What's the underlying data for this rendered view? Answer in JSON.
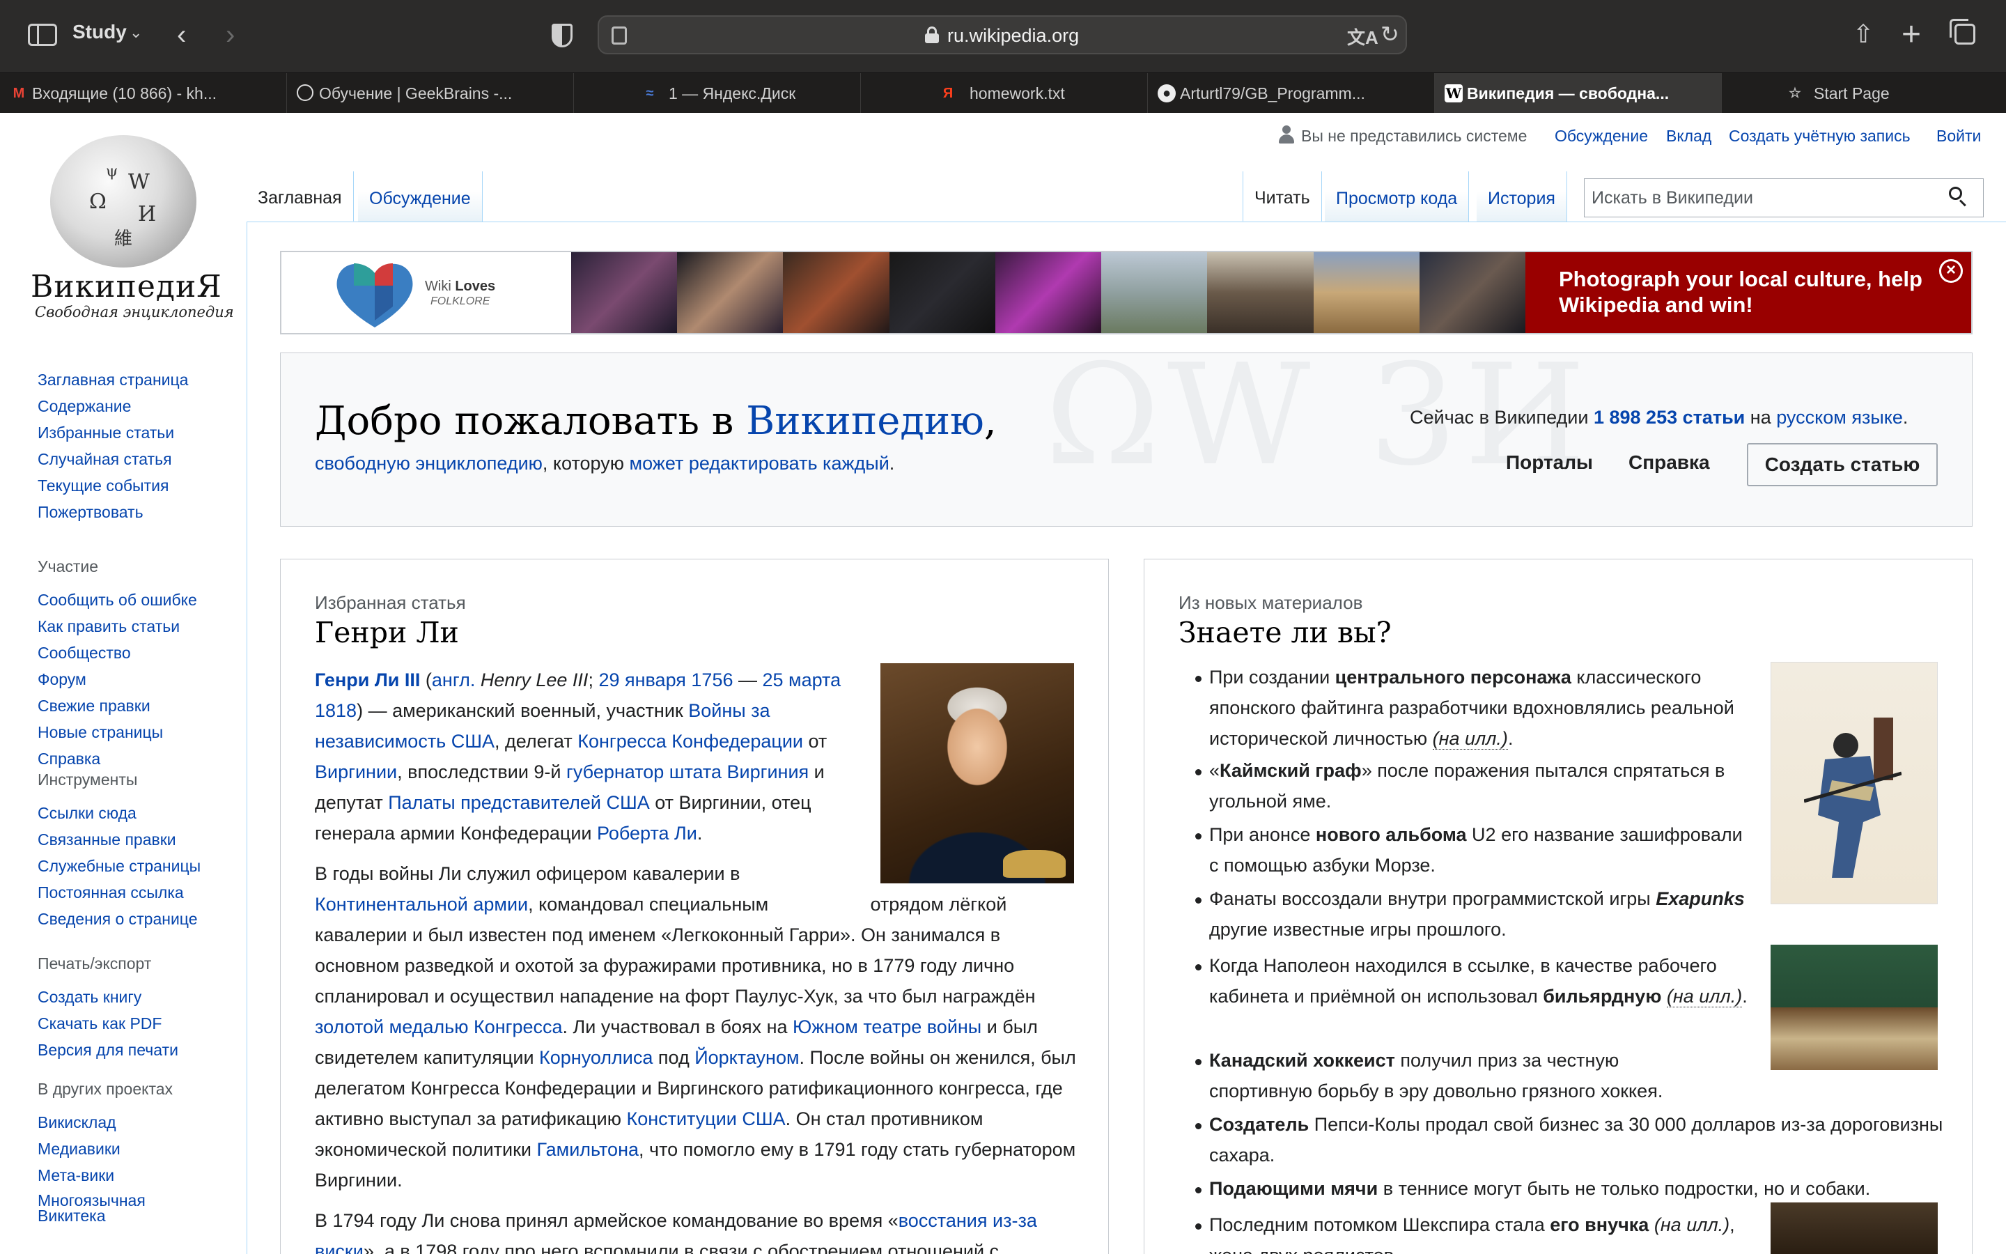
{
  "browser": {
    "tab_group": "Study",
    "url": "ru.wikipedia.org",
    "tabs": [
      {
        "title": "Входящие (10 866) - kh...",
        "icon": "gmail-icon",
        "active": false
      },
      {
        "title": "Обучение | GeekBrains -...",
        "icon": "geekbrains-icon",
        "active": false
      },
      {
        "title": "1 — Яндекс.Диск",
        "icon": "yandex-disk-icon",
        "active": false
      },
      {
        "title": "homework.txt",
        "icon": "yandex-icon",
        "active": false
      },
      {
        "title": "Arturtl79/GB_Programm...",
        "icon": "github-icon",
        "active": false
      },
      {
        "title": "Википедия — свободна...",
        "icon": "wikipedia-icon",
        "active": true
      },
      {
        "title": "Start Page",
        "icon": "star-icon",
        "active": false
      }
    ]
  },
  "personal": {
    "anon": "Вы не представились системе",
    "talk": "Обсуждение",
    "contrib": "Вклад",
    "create_account": "Создать учётную запись",
    "login": "Войти"
  },
  "logo": {
    "wordmark": "ВикипедиЯ",
    "tagline": "Свободная энциклопедия"
  },
  "sidebar": {
    "main": [
      "Заглавная страница",
      "Содержание",
      "Избранные статьи",
      "Случайная статья",
      "Текущие события",
      "Пожертвовать"
    ],
    "participation_heading": "Участие",
    "participation": [
      "Сообщить об ошибке",
      "Как править статьи",
      "Сообщество",
      "Форум",
      "Свежие правки",
      "Новые страницы",
      "Справка"
    ],
    "tools_heading": "Инструменты",
    "tools": [
      "Ссылки сюда",
      "Связанные правки",
      "Служебные страницы",
      "Постоянная ссылка",
      "Сведения о странице"
    ],
    "print_heading": "Печать/экспорт",
    "print": [
      "Создать книгу",
      "Скачать как PDF",
      "Версия для печати"
    ],
    "projects_heading": "В других проектах",
    "projects": [
      "Викисклад",
      "Медиавики",
      "Мета-вики",
      "Многоязычная Викитека"
    ]
  },
  "content_tabs": {
    "main": "Заглавная",
    "talk": "Обсуждение",
    "read": "Читать",
    "view_source": "Просмотр кода",
    "history": "История"
  },
  "search": {
    "placeholder": "Искать в Википедии"
  },
  "banner": {
    "logo_title_a": "Wiki ",
    "logo_title_b": "Loves",
    "logo_sub": "FOLKLORE",
    "cta": "Photograph your local culture, help Wikipedia and win!"
  },
  "welcome": {
    "title_prefix": "Добро пожаловать в ",
    "title_link": "Википедию",
    "title_suffix": ",",
    "sub_link1": "свободную энциклопедию",
    "sub_mid": ", которую ",
    "sub_link2": "может редактировать каждый",
    "sub_end": ".",
    "watermark": "ΩW 3И",
    "stats_prefix": "Сейчас в Википедии ",
    "stats_count": "1 898 253 статьи",
    "stats_mid": " на ",
    "stats_lang": "русском языке",
    "stats_end": ".",
    "portals": "Порталы",
    "help": "Справка",
    "create": "Создать статью"
  },
  "featured": {
    "kicker": "Избранная статья",
    "title": "Генри Ли"
  },
  "dyk": {
    "kicker": "Из новых материалов",
    "title": "Знаете ли вы?"
  }
}
